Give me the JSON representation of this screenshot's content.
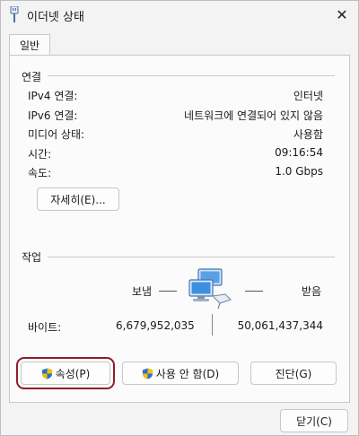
{
  "window": {
    "title": "이더넷 상태",
    "close_glyph": "✕"
  },
  "tabs": [
    {
      "label": "일반"
    }
  ],
  "connection": {
    "group_title": "연결",
    "rows": [
      {
        "label": "IPv4 연결:",
        "value": "인터넷"
      },
      {
        "label": "IPv6 연결:",
        "value": "네트워크에 연결되어 있지 않음"
      },
      {
        "label": "미디어 상태:",
        "value": "사용함"
      },
      {
        "label": "시간:",
        "value": "09:16:54"
      },
      {
        "label": "속도:",
        "value": "1.0 Gbps"
      }
    ],
    "details_button": "자세히(E)..."
  },
  "activity": {
    "group_title": "작업",
    "sent_label": "보냄",
    "received_label": "받음",
    "bytes_label": "바이트:",
    "bytes_sent": "6,679,952,035",
    "bytes_received": "50,061,437,344",
    "icon": "network-computers-icon"
  },
  "buttons": {
    "properties": "속성(P)",
    "disable": "사용 안 함(D)",
    "diagnose": "진단(G)",
    "close": "닫기(C)"
  },
  "colors": {
    "focus_outline": "#8b1e2d",
    "shield_blue": "#2a6fd6",
    "shield_yellow": "#f2c200"
  }
}
